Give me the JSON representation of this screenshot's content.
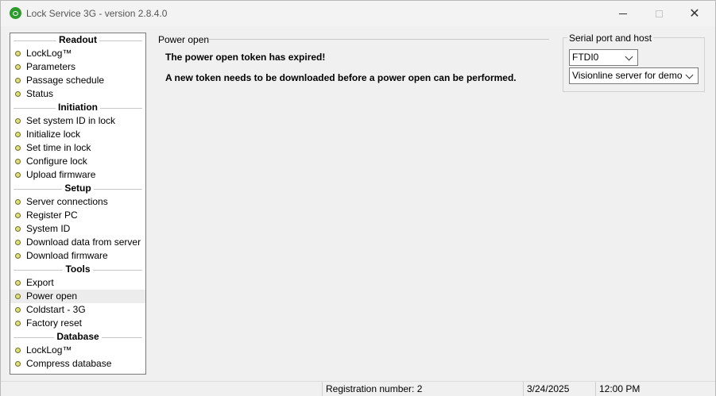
{
  "window": {
    "title": "Lock Service 3G - version 2.8.4.0",
    "controls": {
      "minimize": "minimize",
      "maximize": "maximize",
      "close": "✕"
    }
  },
  "sidebar": {
    "groups": [
      {
        "title": "Readout",
        "items": [
          "LockLog™",
          "Parameters",
          "Passage schedule",
          "Status"
        ]
      },
      {
        "title": "Initiation",
        "items": [
          "Set system ID in lock",
          "Initialize lock",
          "Set time in lock",
          "Configure lock",
          "Upload firmware"
        ]
      },
      {
        "title": "Setup",
        "items": [
          "Server connections",
          "Register PC",
          "System ID",
          "Download data from server",
          "Download firmware"
        ]
      },
      {
        "title": "Tools",
        "items": [
          "Export",
          "Power open",
          "Coldstart - 3G",
          "Factory reset"
        ]
      },
      {
        "title": "Database",
        "items": [
          "LockLog™",
          "Compress database"
        ]
      }
    ],
    "selected": "Power open"
  },
  "main": {
    "section_title": "Power open",
    "message_expired": "The power open token has expired!",
    "message_download": "A new token needs to be downloaded before a power open can be performed."
  },
  "serial": {
    "label": "Serial port and host",
    "port_value": "FTDI0",
    "server_value": "Visionline server for demo"
  },
  "statusbar": {
    "registration": "Registration number: 2",
    "date": "3/24/2025",
    "time": "12:00 PM"
  },
  "icons": {
    "app": "key-icon",
    "bullet": "bullet-icon",
    "dropdown": "chevron-down-icon"
  }
}
